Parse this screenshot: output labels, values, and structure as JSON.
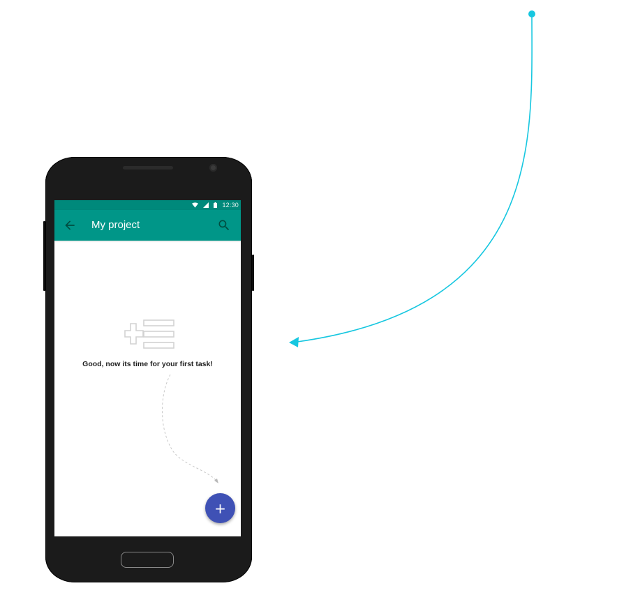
{
  "status_bar": {
    "time": "12:30",
    "icons": [
      "wifi-icon",
      "signal-icon",
      "battery-icon"
    ]
  },
  "app_bar": {
    "title": "My project",
    "back_icon": "arrow-back-icon",
    "search_icon": "search-icon"
  },
  "empty_state": {
    "illustration": "add-list-icon",
    "message": "Good, now its time for your first task!"
  },
  "fab": {
    "label": "+",
    "icon": "plus-icon"
  },
  "colors": {
    "app_bar": "#009688",
    "status_bar": "#00897b",
    "fab": "#3f51b5",
    "connector": "#17c7e0",
    "device": "#1b1b1b"
  }
}
